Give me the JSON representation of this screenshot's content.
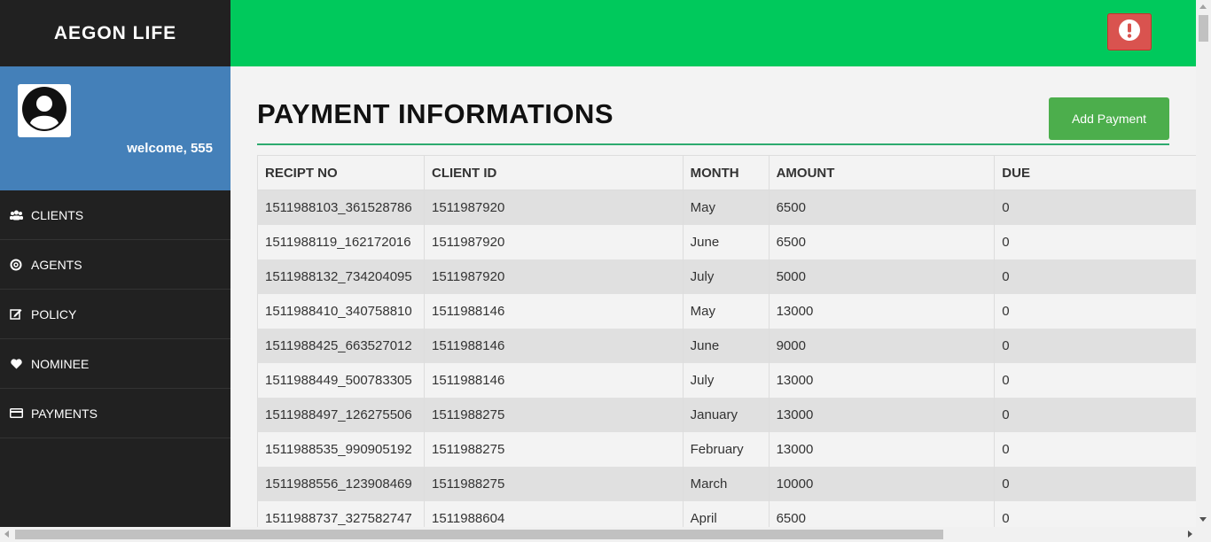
{
  "brand": "AEGON LIFE",
  "welcome": "welcome, 555",
  "nav": [
    {
      "label": "CLIENTS",
      "icon": "users-icon"
    },
    {
      "label": "AGENTS",
      "icon": "lifebuoy-icon"
    },
    {
      "label": "POLICY",
      "icon": "edit-icon"
    },
    {
      "label": "NOMINEE",
      "icon": "heart-icon"
    },
    {
      "label": "PAYMENTS",
      "icon": "credit-card-icon"
    }
  ],
  "topbar": {
    "alert_icon": "exclamation-circle-icon",
    "color": "#00c95c"
  },
  "page": {
    "title": "PAYMENT INFORMATIONS",
    "add_button": "Add Payment"
  },
  "table": {
    "headers": [
      "RECIPT NO",
      "CLIENT ID",
      "MONTH",
      "AMOUNT",
      "DUE"
    ],
    "rows": [
      [
        "1511988103_361528786",
        "1511987920",
        "May",
        "6500",
        "0"
      ],
      [
        "1511988119_162172016",
        "1511987920",
        "June",
        "6500",
        "0"
      ],
      [
        "1511988132_734204095",
        "1511987920",
        "July",
        "5000",
        "0"
      ],
      [
        "1511988410_340758810",
        "1511988146",
        "May",
        "13000",
        "0"
      ],
      [
        "1511988425_663527012",
        "1511988146",
        "June",
        "9000",
        "0"
      ],
      [
        "1511988449_500783305",
        "1511988146",
        "July",
        "13000",
        "0"
      ],
      [
        "1511988497_126275506",
        "1511988275",
        "January",
        "13000",
        "0"
      ],
      [
        "1511988535_990905192",
        "1511988275",
        "February",
        "13000",
        "0"
      ],
      [
        "1511988556_123908469",
        "1511988275",
        "March",
        "10000",
        "0"
      ],
      [
        "1511988737_327582747",
        "1511988604",
        "April",
        "6500",
        "0"
      ]
    ]
  },
  "colors": {
    "sidebar": "#212121",
    "profile": "#4480b9",
    "accent": "#00c95c",
    "button": "#4cae4c",
    "alert": "#d9534f"
  }
}
